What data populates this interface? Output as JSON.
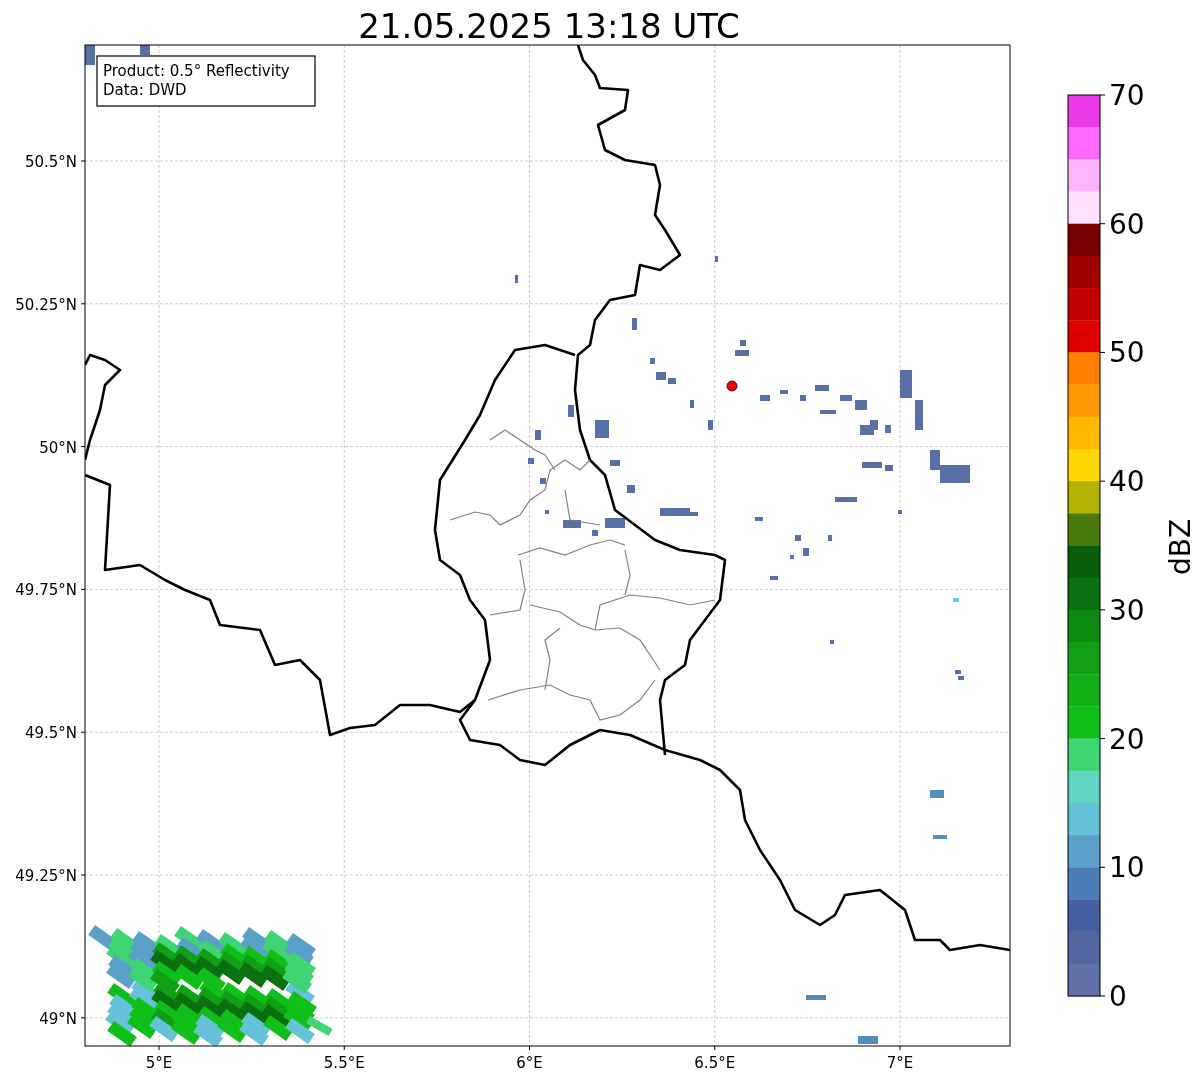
{
  "title": "21.05.2025 13:18 UTC",
  "info_box": [
    "Product: 0.5° Reflectivity",
    "Data: DWD"
  ],
  "map": {
    "lat_ticks": [
      "50.5°N",
      "50.25°N",
      "50°N",
      "49.75°N",
      "49.5°N",
      "49.25°N",
      "49°N"
    ],
    "lon_ticks": [
      "5°E",
      "5.5°E",
      "6°E",
      "6.5°E",
      "7°E"
    ]
  },
  "colorbar": {
    "label": "dBZ",
    "ticks": [
      "70",
      "60",
      "50",
      "40",
      "30",
      "20",
      "10",
      "0"
    ],
    "bands": [
      {
        "color": "#ea3aea"
      },
      {
        "color": "#ff6bff"
      },
      {
        "color": "#ffb4ff"
      },
      {
        "color": "#ffe0ff"
      },
      {
        "color": "#7a0000"
      },
      {
        "color": "#a00000"
      },
      {
        "color": "#c00000"
      },
      {
        "color": "#e00000"
      },
      {
        "color": "#ff7f00"
      },
      {
        "color": "#ff9a00"
      },
      {
        "color": "#ffb800"
      },
      {
        "color": "#ffd700"
      },
      {
        "color": "#b2b200"
      },
      {
        "color": "#4a7a0a"
      },
      {
        "color": "#085e0a"
      },
      {
        "color": "#0b7010"
      },
      {
        "color": "#0d8a12"
      },
      {
        "color": "#10a015"
      },
      {
        "color": "#10b018"
      },
      {
        "color": "#10c018"
      },
      {
        "color": "#3dd672"
      },
      {
        "color": "#5fd6c0"
      },
      {
        "color": "#66c2d8"
      },
      {
        "color": "#5aa0c8"
      },
      {
        "color": "#4c7db6"
      },
      {
        "color": "#4560a2"
      },
      {
        "color": "#5366a0"
      },
      {
        "color": "#6370a6"
      }
    ]
  }
}
